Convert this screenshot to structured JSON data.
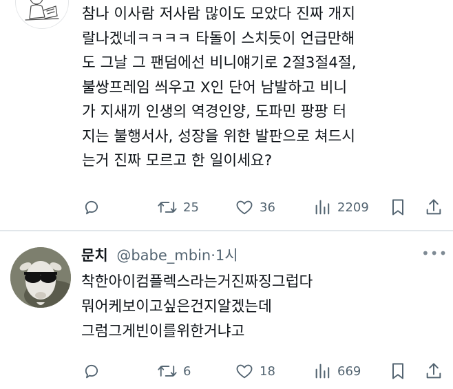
{
  "tweet1": {
    "body_text": "참나 이사람 저사람 많이도 모았다 진짜 개지\n랄나겠네ㅋㅋㅋㅋ 타돌이 스치듯이 언급만해\n도 그날 그 팬덤에선 비니얘기로 2절3절4절,\n불쌍프레임 씌우고 X인 단어 남발하고 비니\n가 지새끼 인생의 역경인양, 도파민 팡팡 터\n지는 불행서사, 성장을 위한 발판으로 쳐드시\n는거 진짜 모르고 한 일이세요?",
    "retweet_count": "25",
    "like_count": "36",
    "view_count": "2209"
  },
  "tweet2": {
    "display_name": "문치",
    "handle": "@babe_mbin",
    "separator": "·",
    "time": "1시",
    "body_text": "착한아이컴플렉스라는거진짜징그럽다\n뭐어케보이고싶은건지알겠는데\n그럼그게빈이를위한거냐고",
    "retweet_count": "6",
    "like_count": "18",
    "view_count": "669"
  },
  "icons": {
    "reply": "reply-icon",
    "retweet": "retweet-icon",
    "like": "heart-icon",
    "views": "views-icon",
    "bookmark": "bookmark-icon",
    "share": "share-icon",
    "more": "more-icon"
  },
  "colors": {
    "text": "#0f1419",
    "secondary": "#536471",
    "divider": "#e1e6ea"
  }
}
